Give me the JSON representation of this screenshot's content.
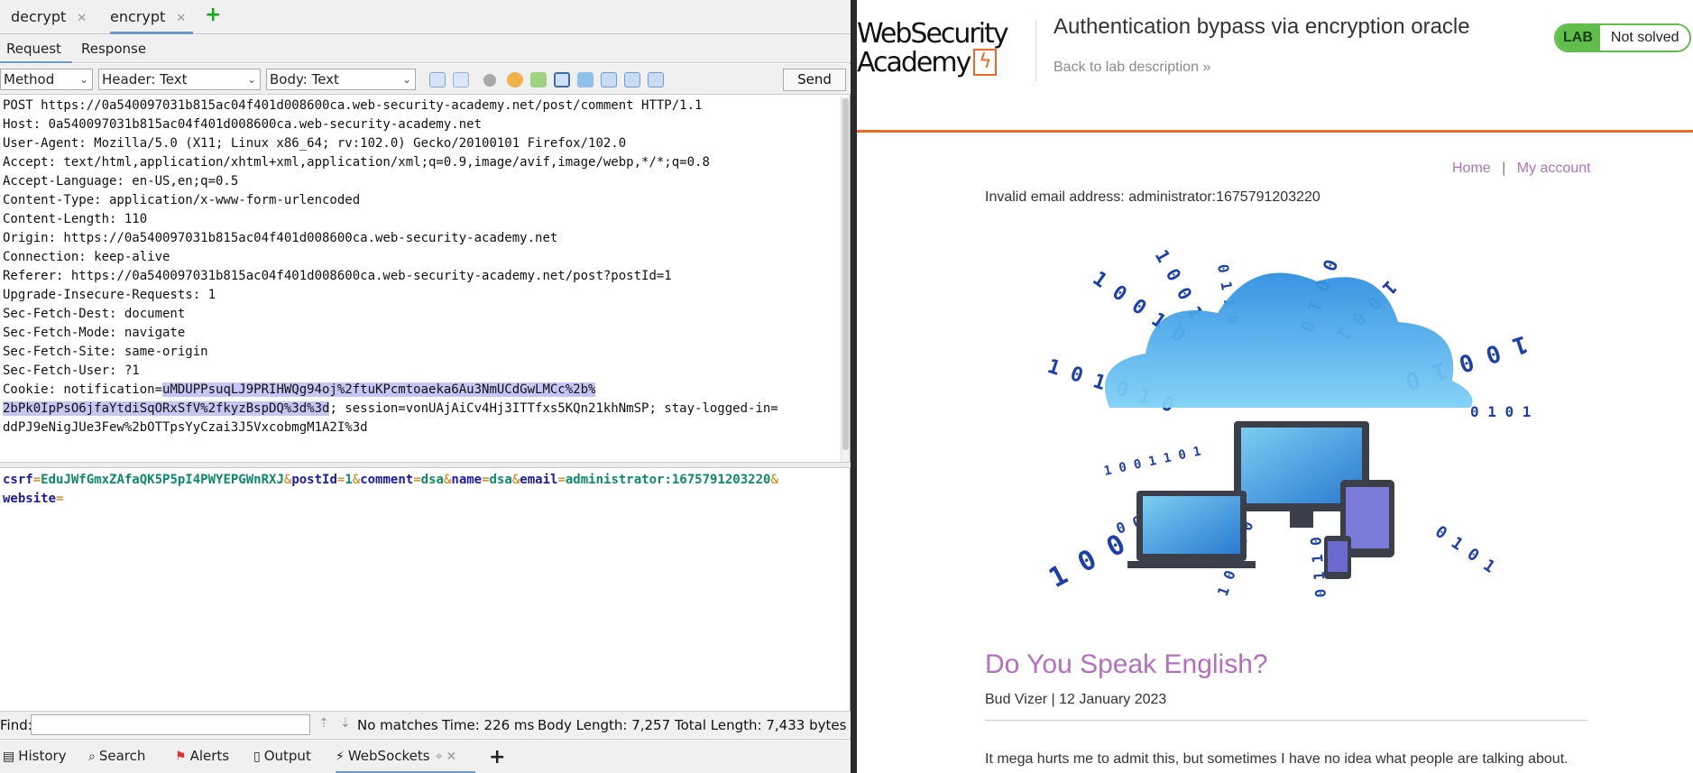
{
  "tool": {
    "tabs": [
      {
        "label": "decrypt"
      },
      {
        "label": "encrypt"
      }
    ],
    "subtabs": {
      "request": "Request",
      "response": "Response"
    },
    "toolbar": {
      "method": "Method",
      "header_view": "Header: Text",
      "body_view": "Body: Text",
      "send": "Send"
    },
    "request_lines": [
      "POST https://0a540097031b815ac04f401d008600ca.web-security-academy.net/post/comment HTTP/1.1",
      "Host: 0a540097031b815ac04f401d008600ca.web-security-academy.net",
      "User-Agent: Mozilla/5.0 (X11; Linux x86_64; rv:102.0) Gecko/20100101 Firefox/102.0",
      "Accept: text/html,application/xhtml+xml,application/xml;q=0.9,image/avif,image/webp,*/*;q=0.8",
      "Accept-Language: en-US,en;q=0.5",
      "Content-Type: application/x-www-form-urlencoded",
      "Content-Length: 110",
      "Origin: https://0a540097031b815ac04f401d008600ca.web-security-academy.net",
      "Connection: keep-alive",
      "Referer: https://0a540097031b815ac04f401d008600ca.web-security-academy.net/post?postId=1",
      "Upgrade-Insecure-Requests: 1",
      "Sec-Fetch-Dest: document",
      "Sec-Fetch-Mode: navigate",
      "Sec-Fetch-Site: same-origin",
      "Sec-Fetch-User: ?1"
    ],
    "cookie": {
      "prefix": "Cookie: notification=",
      "highlight_1": "uMDUPPsuqLJ9PRIHWQg94oj%2ftuKPcmtoaeka6Au3NmUCdGwLMCc%2b%",
      "highlight_2": "2bPk0IpPsO6jfaYtdiSqORxSfV%2fkyzBspDQ%3d%3d",
      "rest_1": "; session=vonUAjAiCv4Hj3ITTfxs5KQn21khNmSP; stay-logged-in=",
      "rest_2": "ddPJ9eNigJUe3Few%2bOTTpsYyCzai3J5VxcobmgM1A2I%3d"
    },
    "body_params": [
      {
        "key": "csrf",
        "value": "EduJWfGmxZAfaQK5P5pI4PWYEPGWnRXJ"
      },
      {
        "key": "postId",
        "value": "1"
      },
      {
        "key": "comment",
        "value": "dsa"
      },
      {
        "key": "name",
        "value": "dsa"
      },
      {
        "key": "email",
        "value": "administrator:1675791203220"
      },
      {
        "key": "website",
        "value": ""
      }
    ],
    "find": {
      "label": "Find:",
      "value": "",
      "matches": "No matches",
      "time": "Time: 226 ms",
      "body_length": "Body Length: 7,257",
      "total_length": "Total Length: 7,433 bytes"
    },
    "bottom_tabs": [
      "History",
      "Search",
      "Alerts",
      "Output",
      "WebSockets"
    ]
  },
  "browser": {
    "logo_line1": "WebSecurity",
    "logo_line2": "Academy",
    "lab_title": "Authentication bypass via encryption oracle",
    "back_link": "Back to lab description",
    "lab_badge": "LAB",
    "lab_status": "Not solved",
    "nav_home": "Home",
    "nav_sep": "|",
    "nav_account": "My account",
    "error_message": "Invalid email address: administrator:1675791203220",
    "post_title": "Do You Speak English?",
    "byline": "Bud Vizer | 12 January 2023",
    "excerpt": "It mega hurts me to admit this, but sometimes I have no idea what people are talking about.",
    "colors": {
      "accent_orange": "#f06a24",
      "link_purple": "#b56fc0",
      "lab_green": "#5fbf4a",
      "binary_blue": "#1c3fae"
    }
  }
}
